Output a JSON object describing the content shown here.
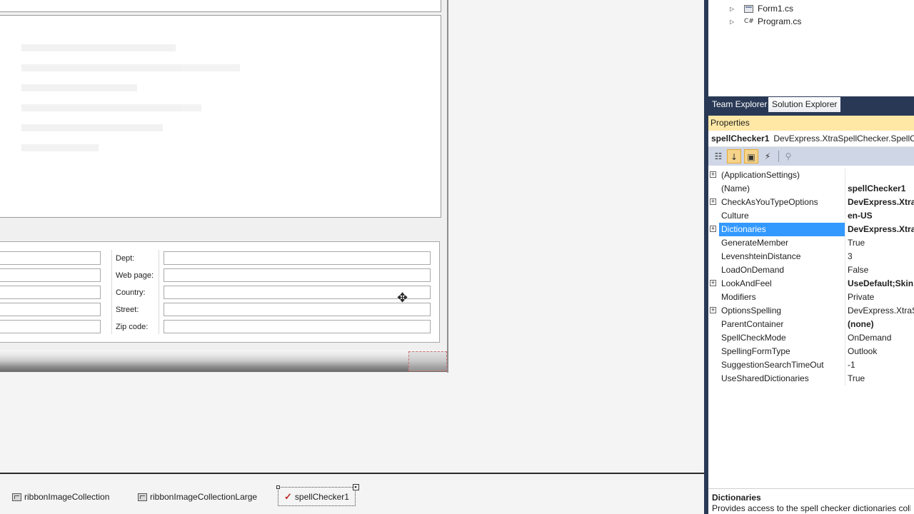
{
  "form": {
    "labels": [
      "Dept:",
      "Web page:",
      "Country:",
      "Street:",
      "Zip code:"
    ]
  },
  "tray": {
    "items": [
      "ribbonImageCollection",
      "ribbonImageCollectionLarge",
      "spellChecker1"
    ]
  },
  "solution_explorer": {
    "nodes": [
      "Form1.cs",
      "Program.cs"
    ]
  },
  "tabs": {
    "team_explorer": "Team Explorer",
    "solution_explorer": "Solution Explorer"
  },
  "properties": {
    "title": "Properties",
    "object_name": "spellChecker1",
    "object_type": "DevExpress.XtraSpellChecker.SpellChecker",
    "rows": [
      {
        "name": "(ApplicationSettings)",
        "value": "",
        "expandable": true,
        "bold": false
      },
      {
        "name": "(Name)",
        "value": "spellChecker1",
        "expandable": false,
        "bold": true
      },
      {
        "name": "CheckAsYouTypeOptions",
        "value": "DevExpress.XtraSpellChecker",
        "expandable": true,
        "bold": true
      },
      {
        "name": "Culture",
        "value": "en-US",
        "expandable": false,
        "bold": true
      },
      {
        "name": "Dictionaries",
        "value": "DevExpress.XtraSpellChecker",
        "expandable": true,
        "bold": true,
        "selected": true
      },
      {
        "name": "GenerateMember",
        "value": "True",
        "expandable": false,
        "bold": false
      },
      {
        "name": "LevenshteinDistance",
        "value": "3",
        "expandable": false,
        "bold": false
      },
      {
        "name": "LoadOnDemand",
        "value": "False",
        "expandable": false,
        "bold": false
      },
      {
        "name": "LookAndFeel",
        "value": "UseDefault;Skin:",
        "expandable": true,
        "bold": true
      },
      {
        "name": "Modifiers",
        "value": "Private",
        "expandable": false,
        "bold": false
      },
      {
        "name": "OptionsSpelling",
        "value": "DevExpress.XtraSpellChecker",
        "expandable": true,
        "bold": false
      },
      {
        "name": "ParentContainer",
        "value": "(none)",
        "expandable": false,
        "bold": true
      },
      {
        "name": "SpellCheckMode",
        "value": "OnDemand",
        "expandable": false,
        "bold": false
      },
      {
        "name": "SpellingFormType",
        "value": "Outlook",
        "expandable": false,
        "bold": false
      },
      {
        "name": "SuggestionSearchTimeOut",
        "value": "-1",
        "expandable": false,
        "bold": false
      },
      {
        "name": "UseSharedDictionaries",
        "value": "True",
        "expandable": false,
        "bold": false
      }
    ],
    "description": {
      "title": "Dictionaries",
      "text": "Provides access to the spell checker dictionaries collection."
    }
  },
  "colors": {
    "tool_window_bg": "#293955",
    "selection": "#3399ff",
    "properties_title_bg": "#ffe8a6"
  }
}
